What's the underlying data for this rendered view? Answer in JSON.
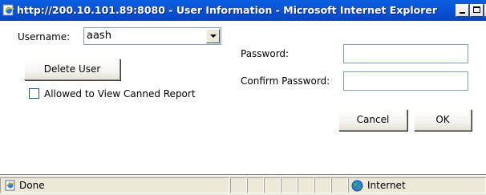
{
  "window": {
    "title": "http://200.10.101.89:8080 - User Information - Microsoft Internet Explorer",
    "title_icon": "ie-page-icon",
    "controls": [
      "minimize-icon",
      "maximize-icon",
      "close-icon"
    ]
  },
  "form": {
    "username_label": "Username:",
    "username_value": "aash",
    "delete_button": "Delete User",
    "checkbox_label": "Allowed to View Canned Report",
    "checkbox_checked": false,
    "password_label": "Password:",
    "password_value": "",
    "confirm_label": "Confirm Password:",
    "confirm_value": "",
    "cancel_button": "Cancel",
    "ok_button": "OK"
  },
  "statusbar": {
    "status_text": "Done",
    "zone_text": "Internet",
    "status_icon": "page-done-icon",
    "zone_icon": "globe-icon"
  }
}
